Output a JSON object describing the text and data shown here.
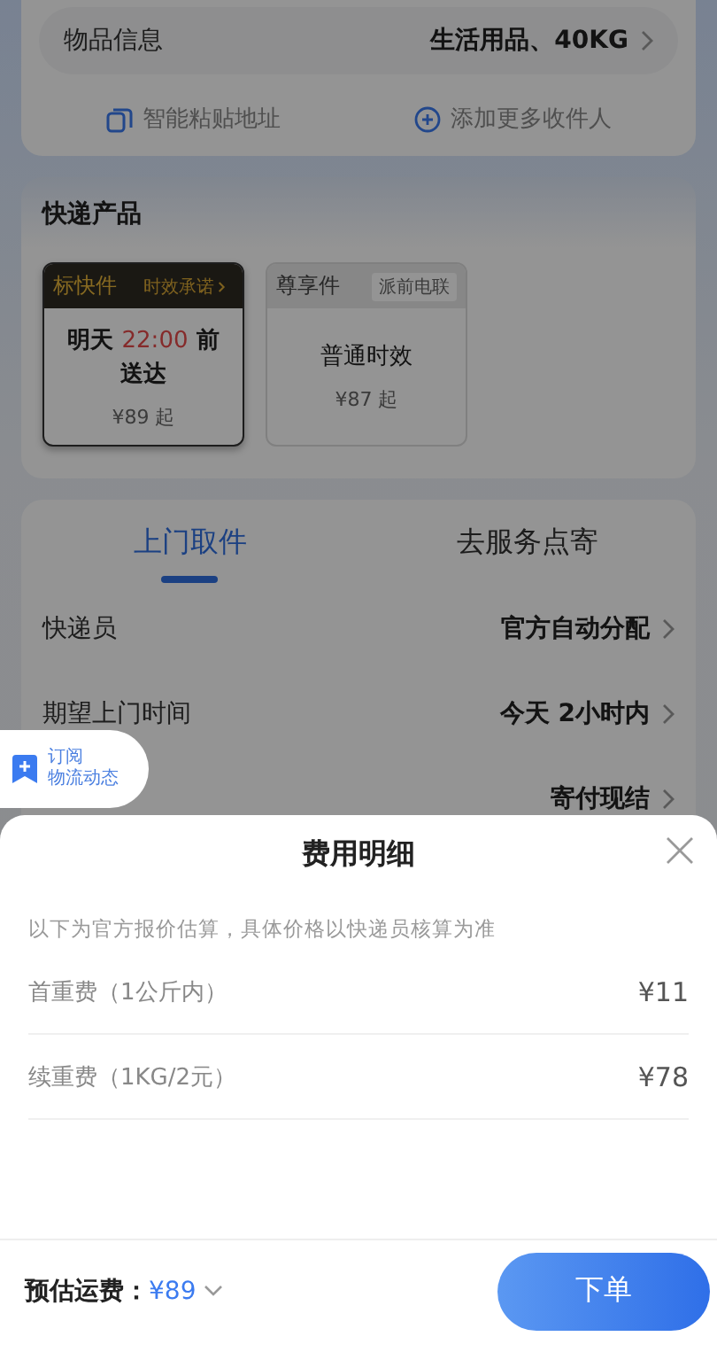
{
  "item_info": {
    "label": "物品信息",
    "value": "生活用品、40KG"
  },
  "quick_actions": [
    {
      "label": "智能粘贴地址",
      "kind": "copy"
    },
    {
      "label": "添加更多收件人",
      "kind": "add"
    }
  ],
  "products": {
    "title": "快递产品",
    "items": [
      {
        "name": "标快件",
        "tag": "时效承诺",
        "selected": true,
        "eta_prefix": "明天",
        "eta_time": "22:00",
        "eta_suffix": "前送达",
        "price": "¥89 起"
      },
      {
        "name": "尊享件",
        "tag": "派前电联",
        "selected": false,
        "eta_prefix": "普通时效",
        "price": "¥87 起"
      }
    ]
  },
  "tabs": [
    {
      "label": "上门取件",
      "selected": true
    },
    {
      "label": "去服务点寄",
      "selected": false
    }
  ],
  "rows": [
    {
      "label": "快递员",
      "value": "官方自动分配"
    },
    {
      "label": "期望上门时间",
      "value": "今天 2小时内"
    },
    {
      "value": "寄付现结"
    }
  ],
  "subscribe_badge": {
    "line1": "订阅",
    "line2": "物流动态"
  },
  "sheet": {
    "title": "费用明细",
    "note": "以下为官方报价估算，具体价格以快递员核算为准",
    "fees": [
      {
        "label": "首重费（1公斤内）",
        "amount": "¥11"
      },
      {
        "label": "续重费（1KG/2元）",
        "amount": "¥78"
      }
    ]
  },
  "footer": {
    "label": "预估运费：",
    "amount": "¥89",
    "button": "下单"
  }
}
